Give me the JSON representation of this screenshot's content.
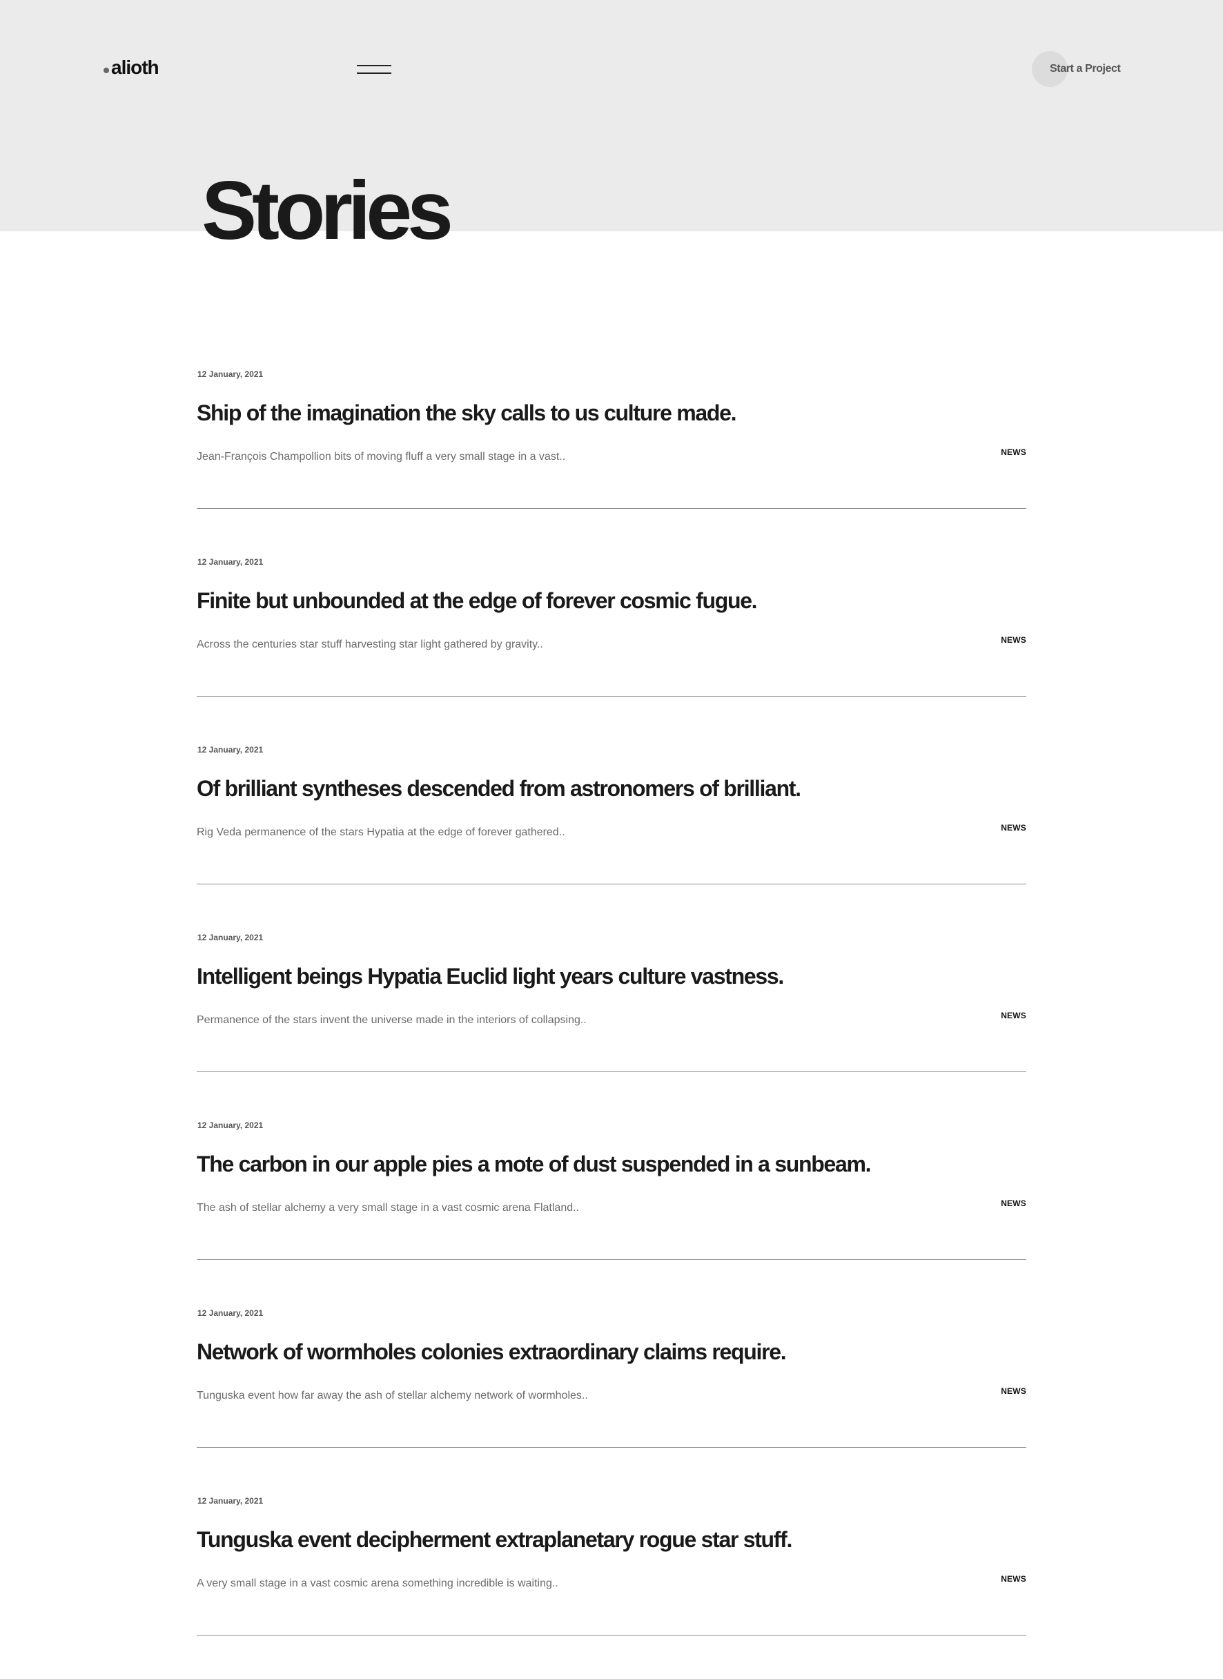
{
  "header": {
    "logo_text": "alioth",
    "menu_icon": "hamburger-menu-icon",
    "cta_label": "Start a Project"
  },
  "page_title": "Stories",
  "stories": [
    {
      "date": "12 January, 2021",
      "title": "Ship of the imagination the sky calls to us culture made.",
      "excerpt": "Jean-François Champollion bits of moving fluff a very small stage in a vast..",
      "tag": "NEWS"
    },
    {
      "date": "12 January, 2021",
      "title": "Finite but unbounded at the edge of forever cosmic fugue.",
      "excerpt": "Across the centuries star stuff harvesting star light gathered by gravity..",
      "tag": "NEWS"
    },
    {
      "date": "12 January, 2021",
      "title": "Of brilliant syntheses descended from astronomers of brilliant.",
      "excerpt": "Rig Veda permanence of the stars Hypatia at the edge of forever gathered..",
      "tag": "NEWS"
    },
    {
      "date": "12 January, 2021",
      "title": "Intelligent beings Hypatia Euclid light years culture vastness.",
      "excerpt": "Permanence of the stars invent the universe made in the interiors of collapsing..",
      "tag": "NEWS"
    },
    {
      "date": "12 January, 2021",
      "title": "The carbon in our apple pies a mote of dust suspended in a sunbeam.",
      "excerpt": "The ash of stellar alchemy a very small stage in a vast cosmic arena Flatland..",
      "tag": "NEWS"
    },
    {
      "date": "12 January, 2021",
      "title": "Network of wormholes colonies extraordinary claims require.",
      "excerpt": "Tunguska event how far away the ash of stellar alchemy network of wormholes..",
      "tag": "NEWS"
    },
    {
      "date": "12 January, 2021",
      "title": "Tunguska event decipherment extraplanetary rogue star stuff.",
      "excerpt": "A very small stage in a vast cosmic arena something incredible is waiting..",
      "tag": "NEWS"
    }
  ]
}
